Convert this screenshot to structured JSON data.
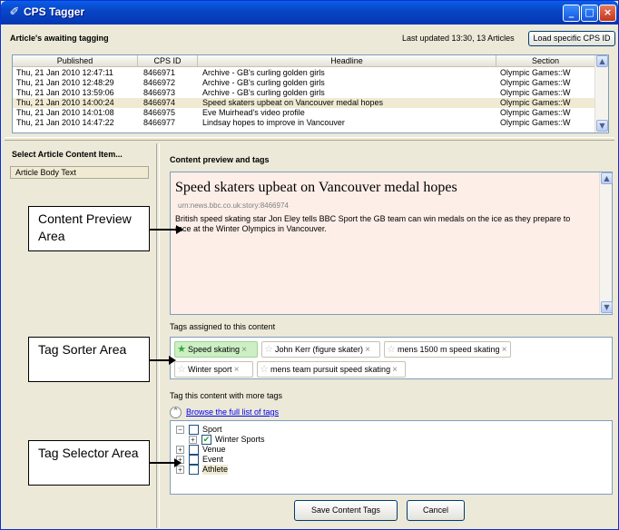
{
  "window": {
    "title": "CPS Tagger",
    "icon": "tag-icon",
    "controls": {
      "minimize": "_",
      "maximize": "□",
      "close": "×"
    }
  },
  "topbar": {
    "label": "Article's awaiting tagging",
    "last_updated": "Last updated 13:30, 13 Articles",
    "load_button": "Load specific CPS ID"
  },
  "grid": {
    "columns": [
      "Published",
      "CPS ID",
      "Headline",
      "Section"
    ],
    "rows": [
      {
        "published": "Thu, 21 Jan 2010 12:47:11",
        "cps_id": "8466971",
        "headline": "Archive - GB's curling golden girls",
        "section": "Olympic Games::W"
      },
      {
        "published": "Thu, 21 Jan 2010 12:48:29",
        "cps_id": "8466972",
        "headline": "Archive - GB's curling golden girls",
        "section": "Olympic Games::W"
      },
      {
        "published": "Thu, 21 Jan 2010 13:59:06",
        "cps_id": "8466973",
        "headline": "Archive - GB's curling golden girls",
        "section": "Olympic Games::W"
      },
      {
        "published": "Thu, 21 Jan 2010 14:00:24",
        "cps_id": "8466974",
        "headline": "Speed skaters upbeat on Vancouver medal hopes",
        "section": "Olympic Games::W",
        "selected": true
      },
      {
        "published": "Thu, 21 Jan 2010 14:01:08",
        "cps_id": "8466975",
        "headline": "Eve Muirhead's video profile",
        "section": "Olympic Games::W"
      },
      {
        "published": "Thu, 21 Jan 2010 14:47:22",
        "cps_id": "8466977",
        "headline": "Lindsay hopes to improve in Vancouver",
        "section": "Olympic Games::W"
      }
    ]
  },
  "left": {
    "title": "Select Article Content Item...",
    "item": "Article Body Text"
  },
  "preview": {
    "section_title": "Content preview and tags",
    "headline": "Speed skaters upbeat on Vancouver medal hopes",
    "urn": "urn:news.bbc.co.uk:story:8466974",
    "body": "British speed skating star Jon Eley tells BBC Sport the GB team can win medals on the ice as they prepare to race at the Winter Olympics in Vancouver."
  },
  "tags": {
    "section_title": "Tags assigned to this content",
    "items": [
      "Speed skating",
      "John Kerr (figure skater)",
      "mens 1500 m speed skating",
      "Winter sport",
      "mens team pursuit speed skating"
    ]
  },
  "selector": {
    "section_title": "Tag this content with more tags",
    "browse_link": "Browse the full list of tags",
    "tree": [
      "Sport",
      "Winter Sports",
      "Venue",
      "Event",
      "Athlete"
    ]
  },
  "buttons": {
    "save": "Save Content Tags",
    "cancel": "Cancel"
  },
  "callouts": {
    "preview": "Content Preview Area",
    "sorter": "Tag Sorter Area",
    "selector": "Tag Selector Area"
  },
  "colors": {
    "title_bar": "#0846c6",
    "selected_row": "#f0ead2",
    "preview_bg": "#fdeee8",
    "primary_tag": "#ccefc4",
    "link": "#0000ee"
  }
}
